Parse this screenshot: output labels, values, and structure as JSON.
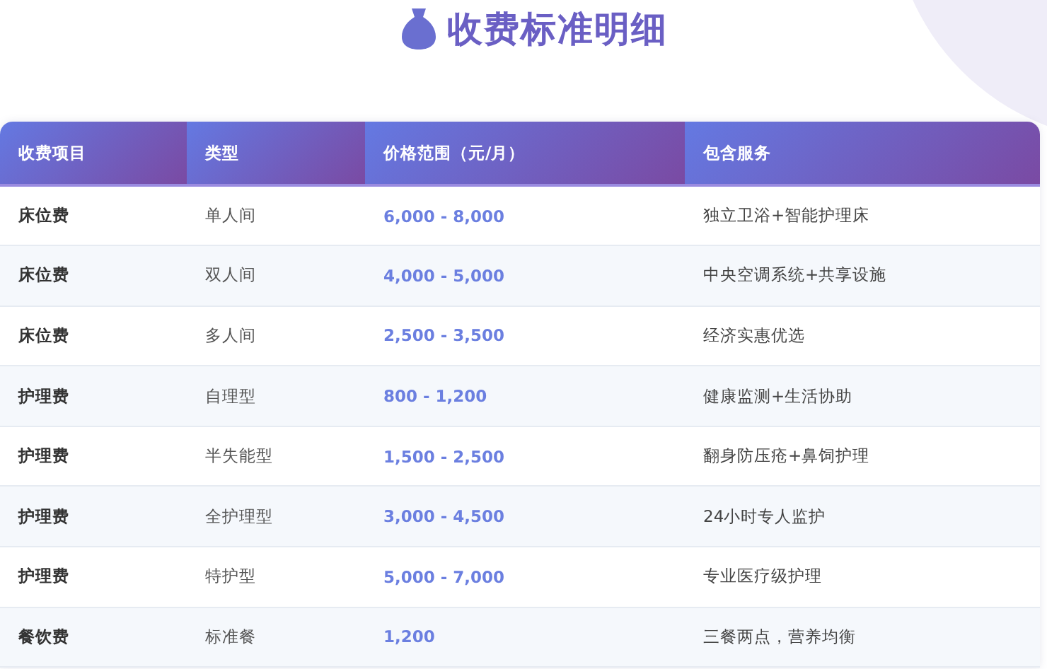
{
  "title": "收费标准明细",
  "table": {
    "columns": [
      "收费项目",
      "类型",
      "价格范围（元/月）",
      "包含服务"
    ],
    "rows": [
      {
        "item": "床位费",
        "type": "单人间",
        "price": "6,000 - 8,000",
        "services": "独立卫浴+智能护理床"
      },
      {
        "item": "床位费",
        "type": "双人间",
        "price": "4,000 - 5,000",
        "services": "中央空调系统+共享设施"
      },
      {
        "item": "床位费",
        "type": "多人间",
        "price": "2,500 - 3,500",
        "services": "经济实惠优选"
      },
      {
        "item": "护理费",
        "type": "自理型",
        "price": "800 - 1,200",
        "services": "健康监测+生活协助"
      },
      {
        "item": "护理费",
        "type": "半失能型",
        "price": "1,500 - 2,500",
        "services": "翻身防压疮+鼻饲护理"
      },
      {
        "item": "护理费",
        "type": "全护理型",
        "price": "3,000 - 4,500",
        "services": "24小时专人监护"
      },
      {
        "item": "护理费",
        "type": "特护型",
        "price": "5,000 - 7,000",
        "services": "专业医疗级护理"
      },
      {
        "item": "餐饮费",
        "type": "标准餐",
        "price": "1,200",
        "services": "三餐两点，营养均衡"
      }
    ]
  }
}
